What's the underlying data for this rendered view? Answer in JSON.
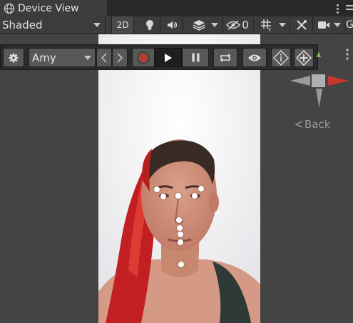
{
  "tab": {
    "title": "Device View",
    "icon": "globe-icon"
  },
  "toolbar": {
    "shading_mode": "Shaded",
    "mode_2d_label": "2D",
    "hidden_count": "0",
    "icons": [
      "lightbulb-icon",
      "audio-icon",
      "effects-icon",
      "visibility-off-icon",
      "grid-icon",
      "tools-icon",
      "camera-icon"
    ]
  },
  "ar_toolbar": {
    "avatar": "Amy",
    "icons": [
      "gear-icon",
      "chevron-left-icon",
      "chevron-right-icon",
      "record-icon",
      "play-icon",
      "pause-icon",
      "loop-icon",
      "eye-icon",
      "info-icon",
      "move-icon"
    ],
    "playing": true
  },
  "gizmo": {
    "back_label": "Back"
  },
  "colors": {
    "panel": "#3c3c3c",
    "background": "#444444",
    "record": "#c23a2b",
    "gizmo_x": "#c8372d",
    "gizmo_y": "#7fbf3f"
  }
}
